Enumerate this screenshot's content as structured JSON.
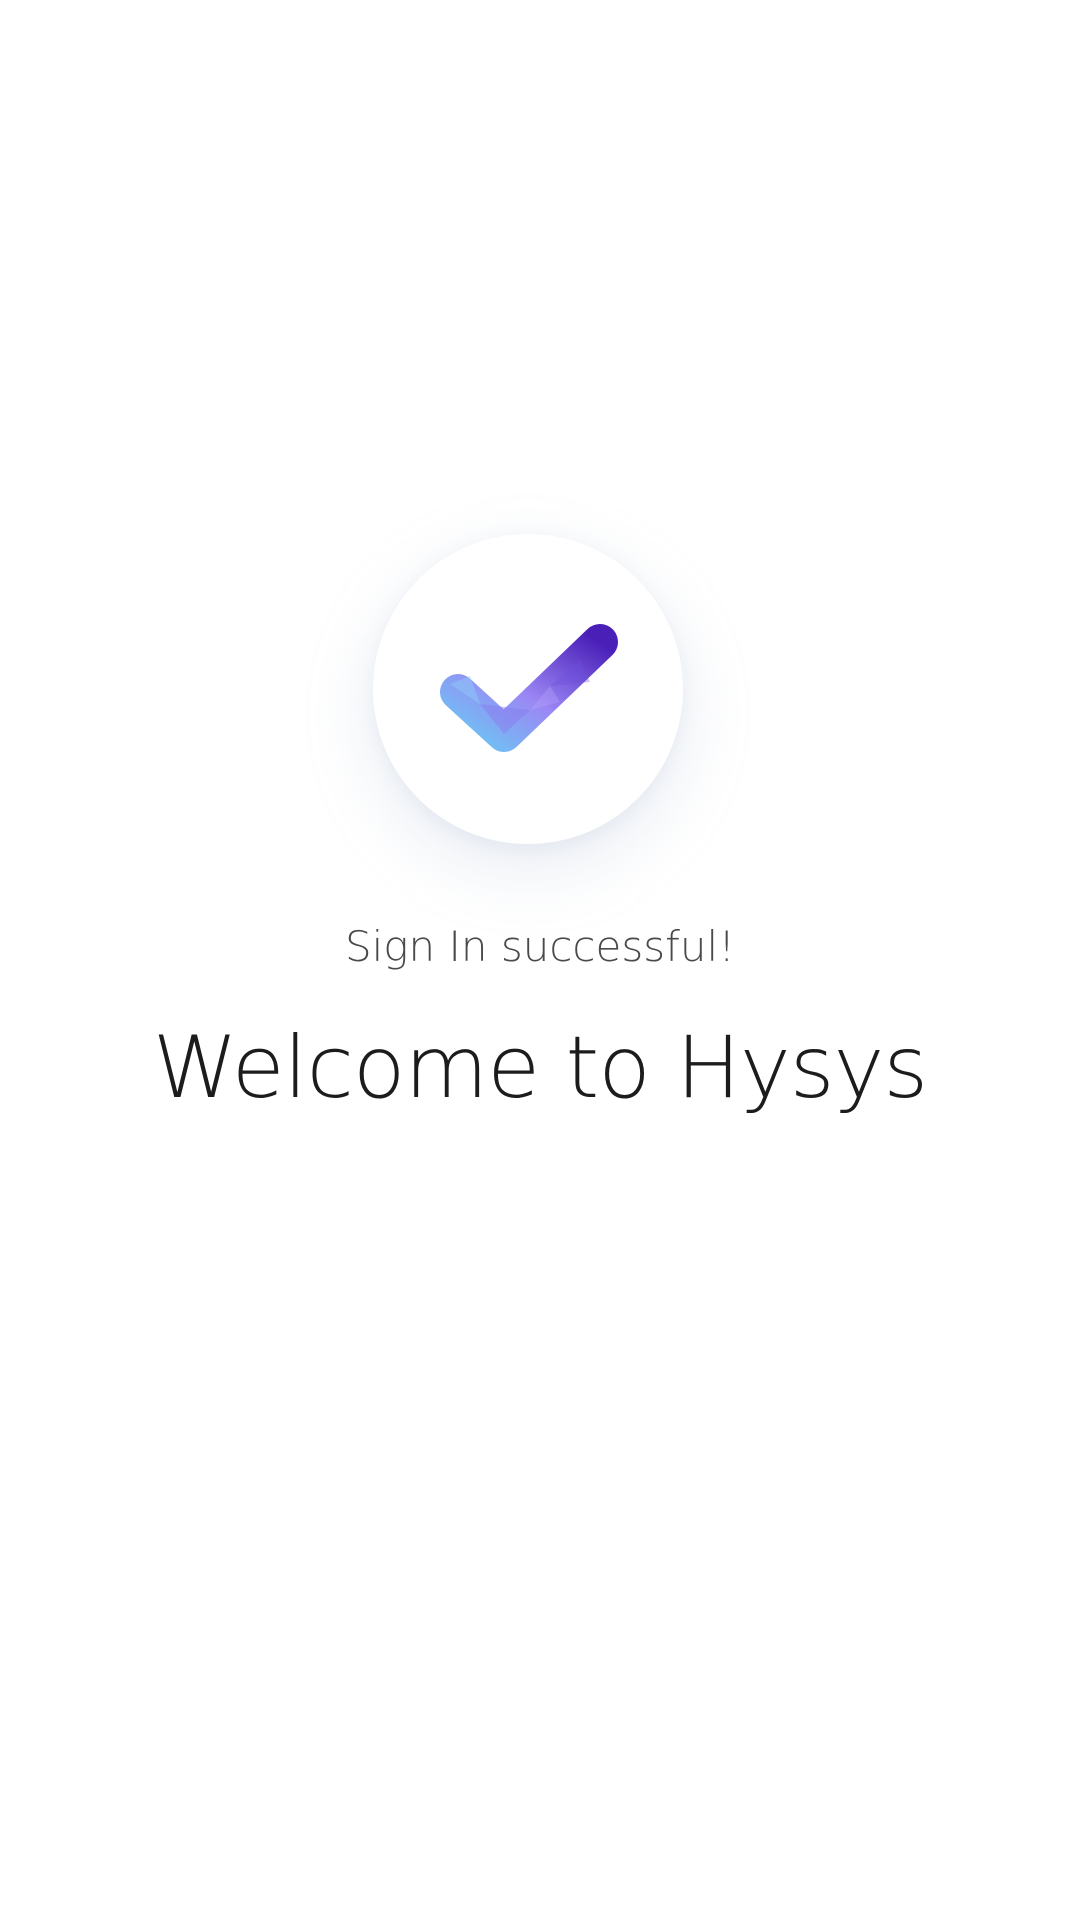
{
  "icons": {
    "success": "check-icon"
  },
  "colors": {
    "background": "#ffffff",
    "status_text": "#4a4a4a",
    "title_text": "#1c1c1c",
    "check_gradient_start": "#6ec3f4",
    "check_gradient_mid": "#9b87f5",
    "check_gradient_end": "#4a1fb8"
  },
  "message": {
    "status": "Sign In successful!",
    "title": "Welcome to Hysys"
  }
}
